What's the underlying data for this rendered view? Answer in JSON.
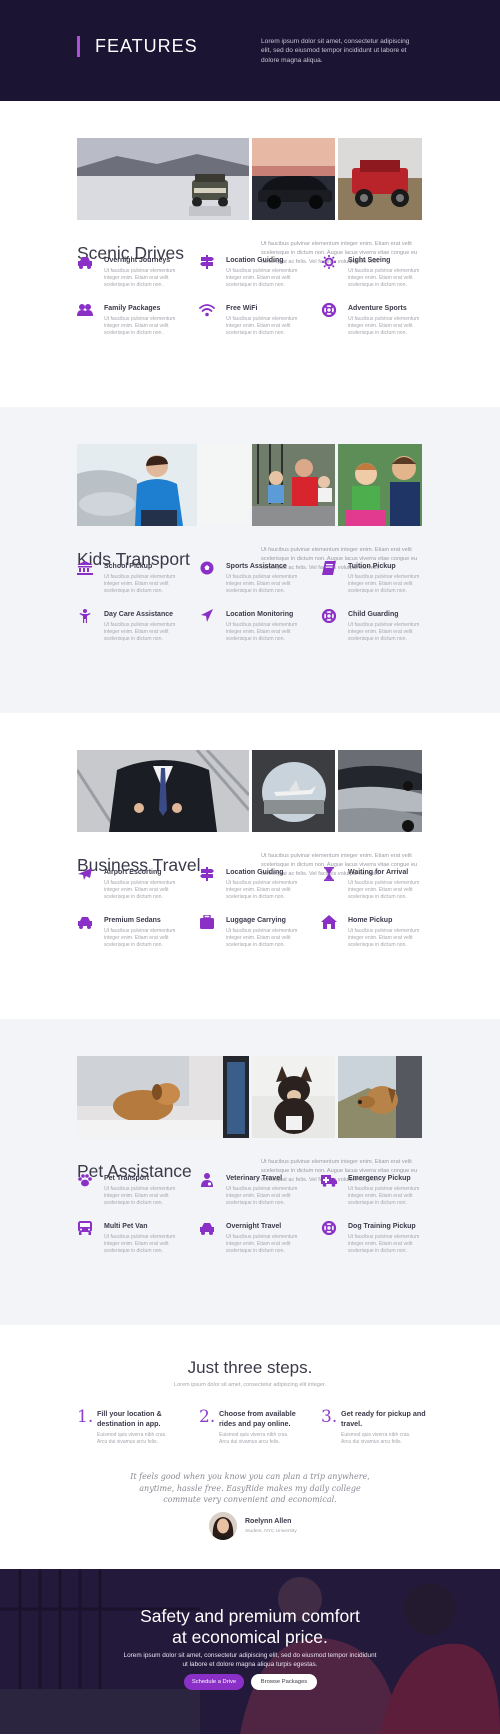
{
  "hero": {
    "title": "FEATURES",
    "text": "Lorem ipsum dolor sit amet, consectetur adipiscing elit, sed do eiusmod tempor incididunt ut labore et dolore magna aliqua."
  },
  "colors": {
    "accent": "#8a30c6",
    "hero_bg": "#1b1432",
    "alt_bg": "#f3f4f7"
  },
  "feature_desc": "Ut faucibus pulvinar elementum integer enim. Etiam erat velit scelerisque in dictum non.",
  "sections": [
    {
      "title": "Scenic Drives",
      "desc": "Ut faucibus pulvinar elementum integer enim. Etiam erat velit scelerisque in dictum non. Augue lacus viverra vitae congue eu consequat ac felis. Vel facilisis volutpat est velit.",
      "features": [
        {
          "name": "Overnight Journeys",
          "icon": "car-icon"
        },
        {
          "name": "Location Guiding",
          "icon": "signpost-icon"
        },
        {
          "name": "Sight Seeing",
          "icon": "sun-icon"
        },
        {
          "name": "Family Packages",
          "icon": "users-icon"
        },
        {
          "name": "Free WiFi",
          "icon": "wifi-icon"
        },
        {
          "name": "Adventure Sports",
          "icon": "lifebuoy-icon"
        }
      ]
    },
    {
      "title": "Kids Transport",
      "desc": "Ut faucibus pulvinar elementum integer enim. Etiam erat velit scelerisque in dictum non. Augue lacus viverra vitae congue eu consequat ac felis. Vel facilisis volutpat est velit.",
      "features": [
        {
          "name": "School Pickup",
          "icon": "school-icon"
        },
        {
          "name": "Sports Assistance",
          "icon": "ball-icon"
        },
        {
          "name": "Tuition Pickup",
          "icon": "book-icon"
        },
        {
          "name": "Day Care Assistance",
          "icon": "child-icon"
        },
        {
          "name": "Location Monitoring",
          "icon": "location-arrow-icon"
        },
        {
          "name": "Child Guarding",
          "icon": "lifebuoy-icon"
        }
      ]
    },
    {
      "title": "Business Travel",
      "desc": "Ut faucibus pulvinar elementum integer enim. Etiam erat velit scelerisque in dictum non. Augue lacus viverra vitae congue eu consequat ac felis. Vel facilisis volutpat est velit.",
      "features": [
        {
          "name": "Airport Escorting",
          "icon": "plane-icon"
        },
        {
          "name": "Location Guiding",
          "icon": "signpost-icon"
        },
        {
          "name": "Waiting for Arrival",
          "icon": "hourglass-icon"
        },
        {
          "name": "Premium Sedans",
          "icon": "car-icon"
        },
        {
          "name": "Luggage Carrying",
          "icon": "suitcase-icon"
        },
        {
          "name": "Home Pickup",
          "icon": "home-icon"
        }
      ]
    },
    {
      "title": "Pet Assistance",
      "desc": "Ut faucibus pulvinar elementum integer enim. Etiam erat velit scelerisque in dictum non. Augue lacus viverra vitae congue eu consequat ac felis. Vel facilisis volutpat est velit.",
      "features": [
        {
          "name": "Pet Transport",
          "icon": "paw-icon"
        },
        {
          "name": "Veterinary Travel",
          "icon": "doctor-icon"
        },
        {
          "name": "Emergency Pickup",
          "icon": "ambulance-icon"
        },
        {
          "name": "Multi Pet Van",
          "icon": "van-icon"
        },
        {
          "name": "Overnight Travel",
          "icon": "car-icon"
        },
        {
          "name": "Dog Training Pickup",
          "icon": "lifebuoy-icon"
        }
      ]
    }
  ],
  "steps": {
    "title": "Just three steps.",
    "subtitle": "Lorem ipsum dolor sit amet, consectetur adipiscing elit integer.",
    "items": [
      {
        "num": "1.",
        "title": "Fill your location & destination in app.",
        "desc": "Euismod quis viverra nibh cras. Arcu dui vivamus arcu felis."
      },
      {
        "num": "2.",
        "title": "Choose from available rides and pay online.",
        "desc": "Euismod quis viverra nibh cras. Arcu dui vivamus arcu felis."
      },
      {
        "num": "3.",
        "title": "Get ready for pickup and travel.",
        "desc": "Euismod quis viverra nibh cras. Arcu dui vivamus arcu felis."
      }
    ],
    "quote": "It feels good when you know you can plan a trip anywhere, anytime, hassle free. EasyRide makes my daily college commute very convenient and economical.",
    "author_name": "Roelynn Allen",
    "author_role": "Student, NYC University"
  },
  "cta": {
    "title_line1": "Safety and premium comfort",
    "title_line2": "at economical price.",
    "text": "Lorem ipsum dolor sit amet, consectetur adipiscing elit, sed do eiusmod tempor incididunt ut labore et dolore magna aliqua turpis egestas.",
    "primary_button": "Schedule a Drive",
    "secondary_button": "Browse Packages"
  }
}
